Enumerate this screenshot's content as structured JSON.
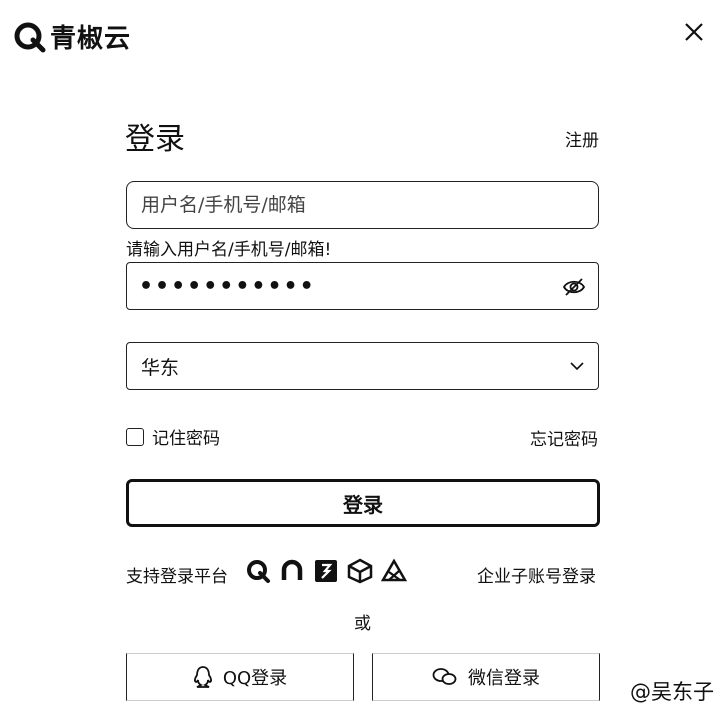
{
  "header": {
    "brand_name": "青椒云",
    "logo_icon": "brand-q-logo-icon",
    "close_icon": "close-icon"
  },
  "login": {
    "title": "登录",
    "register_label": "注册",
    "username_placeholder": "用户名/手机号/邮箱",
    "username_value": "",
    "username_error": "请输入用户名/手机号/邮箱!",
    "password_masked": "•••••••••••",
    "password_toggle_icon": "eye-off-icon",
    "region_value": "华东",
    "region_dropdown_icon": "chevron-down-icon",
    "remember_label": "记住密码",
    "remember_checked": false,
    "forgot_label": "忘记密码",
    "submit_label": "登录"
  },
  "platforms": {
    "label": "支持登录平台",
    "icons": [
      "q-platform-icon",
      "arc-platform-icon",
      "box-platform-icon",
      "cube-platform-icon",
      "triangle-platform-icon"
    ],
    "enterprise_label": "企业子账号登录"
  },
  "divider_text": "或",
  "social": {
    "qq_label": "QQ登录",
    "qq_icon": "qq-penguin-icon",
    "wechat_label": "微信登录",
    "wechat_icon": "wechat-icon"
  },
  "watermark": "@吴东子"
}
